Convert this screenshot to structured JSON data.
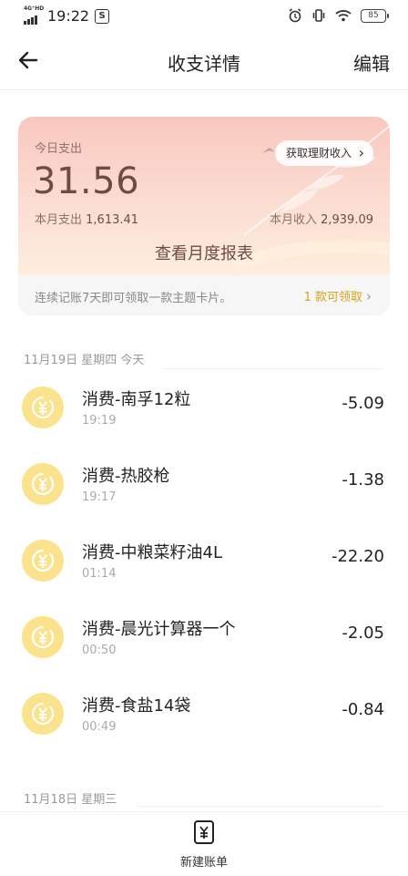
{
  "status_bar": {
    "network": "4G⁺HD",
    "time": "19:22",
    "notif_icon": "S",
    "battery": "85",
    "icons": [
      "alarm-icon",
      "vibrate-icon",
      "wifi-icon",
      "battery-icon"
    ]
  },
  "header": {
    "title": "收支详情",
    "edit_label": "编辑"
  },
  "summary": {
    "today_label": "今日支出",
    "today_value": "31.56",
    "month_expense_label": "本月支出",
    "month_expense_value": "1,613.41",
    "month_income_label": "本月收入",
    "month_income_value": "2,939.09",
    "finance_button": "获取理财收入",
    "report_button": "查看月度报表",
    "streak_text": "连续记账7天即可领取一款主题卡片。",
    "claim_text": "1 款可领取",
    "colors": {
      "accent": "#d9a21b",
      "card_text": "#6e4c42"
    }
  },
  "groups": [
    {
      "date": "11月19日 星期四 今天",
      "items": [
        {
          "title": "消费-南孚12粒",
          "time": "19:19",
          "amount": "-5.09"
        },
        {
          "title": "消费-热胶枪",
          "time": "19:17",
          "amount": "-1.38"
        },
        {
          "title": "消费-中粮菜籽油4L",
          "time": "01:14",
          "amount": "-22.20"
        },
        {
          "title": "消费-晨光计算器一个",
          "time": "00:50",
          "amount": "-2.05"
        },
        {
          "title": "消费-食盐14袋",
          "time": "00:49",
          "amount": "-0.84"
        }
      ]
    },
    {
      "date": "11月18日 星期三",
      "items": []
    }
  ],
  "bottom": {
    "new_bill_label": "新建账单"
  }
}
